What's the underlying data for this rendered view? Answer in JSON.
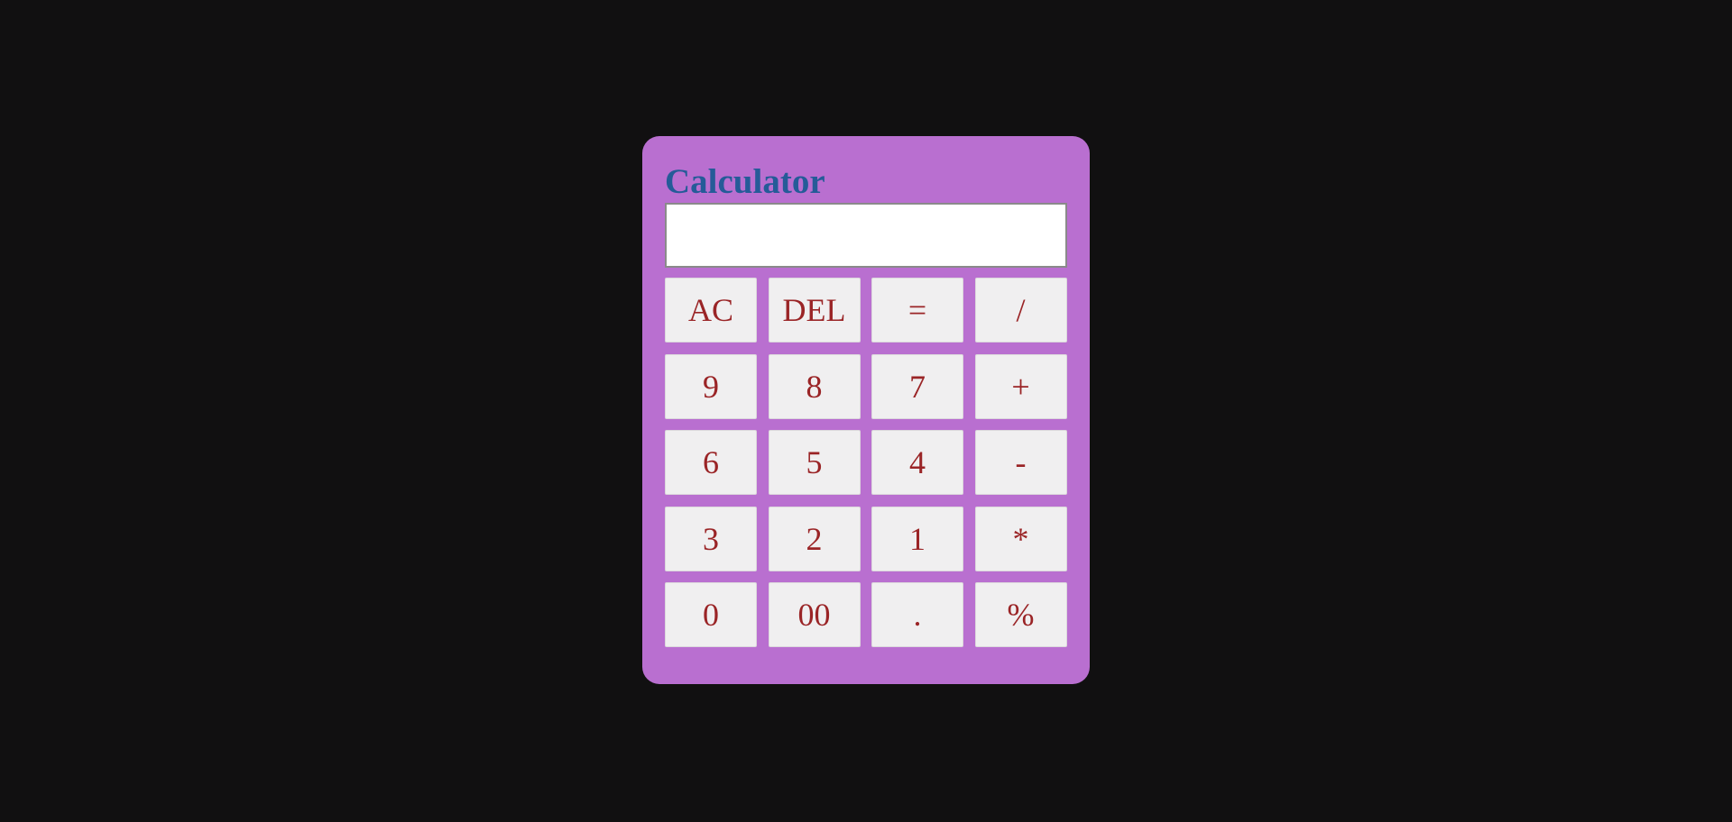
{
  "calculator": {
    "title": "Calculator",
    "display_value": "",
    "colors": {
      "page_background": "#111011",
      "body": "#b96fd0",
      "title": "#255b98",
      "key_background": "#f0eff0",
      "key_text": "#9a2426",
      "display_background": "#ffffff"
    },
    "keys": [
      {
        "label": "AC"
      },
      {
        "label": "DEL"
      },
      {
        "label": "="
      },
      {
        "label": "/"
      },
      {
        "label": "9"
      },
      {
        "label": "8"
      },
      {
        "label": "7"
      },
      {
        "label": "+"
      },
      {
        "label": "6"
      },
      {
        "label": "5"
      },
      {
        "label": "4"
      },
      {
        "label": "-"
      },
      {
        "label": "3"
      },
      {
        "label": "2"
      },
      {
        "label": "1"
      },
      {
        "label": "*"
      },
      {
        "label": "0"
      },
      {
        "label": "00"
      },
      {
        "label": "."
      },
      {
        "label": "%"
      }
    ]
  }
}
